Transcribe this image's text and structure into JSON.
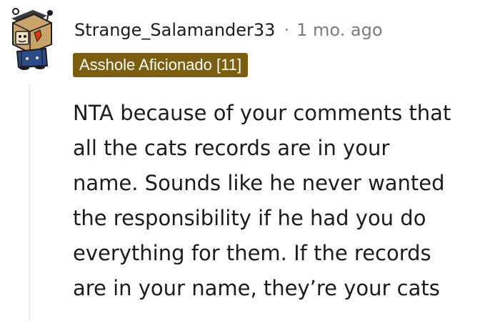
{
  "comment": {
    "author": "Strange_Salamander33",
    "separator": "·",
    "timestamp": "1 mo. ago",
    "flair": {
      "text": "Asshole Aficionado [11]",
      "color": "#7b5e0f",
      "text_color": "#ffffff"
    },
    "avatar_icon": "snoo-robot-box-avatar",
    "body_lines": [
      "NTA because of your comments that",
      "all the cats records are in your",
      "name. Sounds like he never wanted",
      "the responsibility if he had you do",
      "everything for them. If the records",
      "are in your name, they’re your cats"
    ]
  }
}
